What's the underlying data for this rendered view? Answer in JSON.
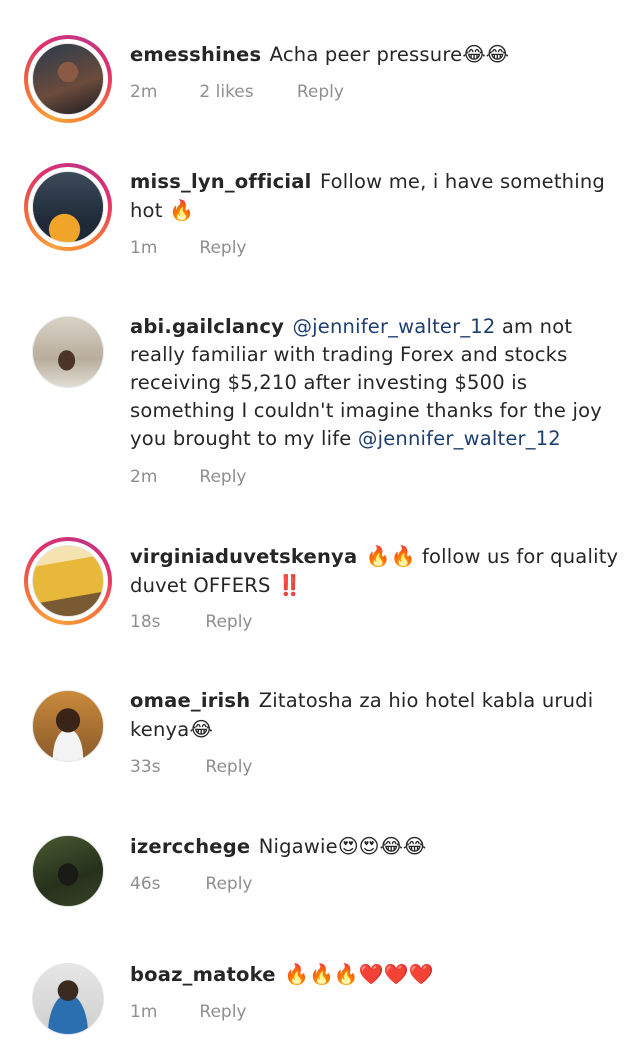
{
  "comments": [
    {
      "username": "emesshines",
      "text": "Acha peer pressure",
      "emoji": "😂😂",
      "time": "2m",
      "likes": "2 likes",
      "reply": "Reply",
      "story_ring": true,
      "avatar_colors": [
        "#1b2a3a",
        "#6a4b3a"
      ]
    },
    {
      "username": "miss_lyn_official",
      "text": "Follow me,  i have something hot",
      "emoji": "🔥",
      "time": "1m",
      "reply": "Reply",
      "story_ring": true,
      "avatar_colors": [
        "#2b3a4a",
        "#e7a53a"
      ]
    },
    {
      "username": "abi.gailclancy",
      "mention1": "@jennifer_walter_12",
      "text": "am not really familiar with trading Forex and stocks receiving $5,210 after investing $500 is something I couldn't imagine thanks for the joy you brought to my life",
      "mention2": "@jennifer_walter_12",
      "time": "2m",
      "reply": "Reply",
      "story_ring": false,
      "avatar_colors": [
        "#c9c4bb",
        "#5a4636"
      ]
    },
    {
      "username": "virginiaduvetskenya",
      "emoji_lead": "🔥🔥",
      "text": "follow us for quality duvet OFFERS",
      "emoji": "‼️",
      "time": "18s",
      "reply": "Reply",
      "story_ring": true,
      "avatar_colors": [
        "#e3b53c",
        "#8a6a3a"
      ]
    },
    {
      "username": "omae_irish",
      "text": "Zitatosha za hio hotel kabla urudi kenya",
      "emoji": "😂",
      "time": "33s",
      "reply": "Reply",
      "story_ring": false,
      "avatar_colors": [
        "#b9762f",
        "#3a2418"
      ]
    },
    {
      "username": "izercchege",
      "text": "Nigawie",
      "emoji": "😍😍😂😂",
      "time": "46s",
      "reply": "Reply",
      "story_ring": false,
      "avatar_colors": [
        "#2e3a22",
        "#1a1a14"
      ]
    },
    {
      "username": "boaz_matoke",
      "emoji_lead": "🔥🔥🔥❤️❤️❤️",
      "time": "1m",
      "reply": "Reply",
      "story_ring": false,
      "avatar_colors": [
        "#d9d9d9",
        "#2c6fb0"
      ]
    }
  ]
}
